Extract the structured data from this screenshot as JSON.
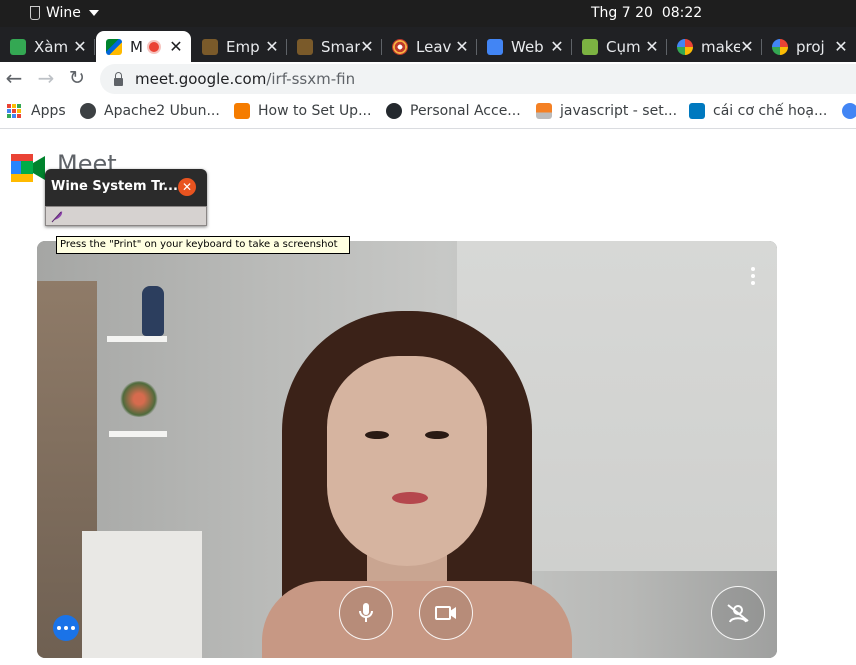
{
  "system_bar": {
    "app_name": "Wine",
    "date": "Thg 7 20",
    "time": "08:22"
  },
  "tabs": [
    {
      "title": "Xàm",
      "icon": "chat-icon",
      "color": "#34a853",
      "active": false
    },
    {
      "title": "M",
      "icon": "meet-icon",
      "color": "#00897b",
      "active": true,
      "recording": true
    },
    {
      "title": "Emp",
      "icon": "book-icon",
      "color": "#7a5a2a",
      "active": false
    },
    {
      "title": "Smar",
      "icon": "book-icon",
      "color": "#7a5a2a",
      "active": false
    },
    {
      "title": "Leav",
      "icon": "target-icon",
      "color": "#c0392b",
      "active": false
    },
    {
      "title": "Web",
      "icon": "docs-icon",
      "color": "#4285f4",
      "active": false
    },
    {
      "title": "Cụm",
      "icon": "image-icon",
      "color": "#7cb342",
      "active": false
    },
    {
      "title": "make",
      "icon": "google-icon",
      "color": "#4285f4",
      "active": false
    },
    {
      "title": "proj",
      "icon": "google-icon",
      "color": "#4285f4",
      "active": false
    }
  ],
  "address_bar": {
    "domain": "meet.google.com",
    "path": "/irf-ssxm-fin"
  },
  "bookmarks": [
    {
      "label": "Apps",
      "icon": "apps-grid-icon"
    },
    {
      "label": "Apache2 Ubun...",
      "icon": "globe-icon"
    },
    {
      "label": "How to Set Up...",
      "icon": "tns-icon"
    },
    {
      "label": "Personal Acce...",
      "icon": "github-icon"
    },
    {
      "label": "javascript - set...",
      "icon": "stackoverflow-icon"
    },
    {
      "label": "cái cơ chế hoạ...",
      "icon": "trello-icon"
    }
  ],
  "meet": {
    "logo_text": "Meet"
  },
  "wine_popup": {
    "title": "Wine System Tr...",
    "tooltip": "Press the \"Print\" on your keyboard to take a screenshot"
  },
  "colors": {
    "tab_strip": "#202124",
    "accent_blue": "#1a73e8",
    "wine_close": "#e95420",
    "tooltip_bg": "#ffffe1"
  }
}
